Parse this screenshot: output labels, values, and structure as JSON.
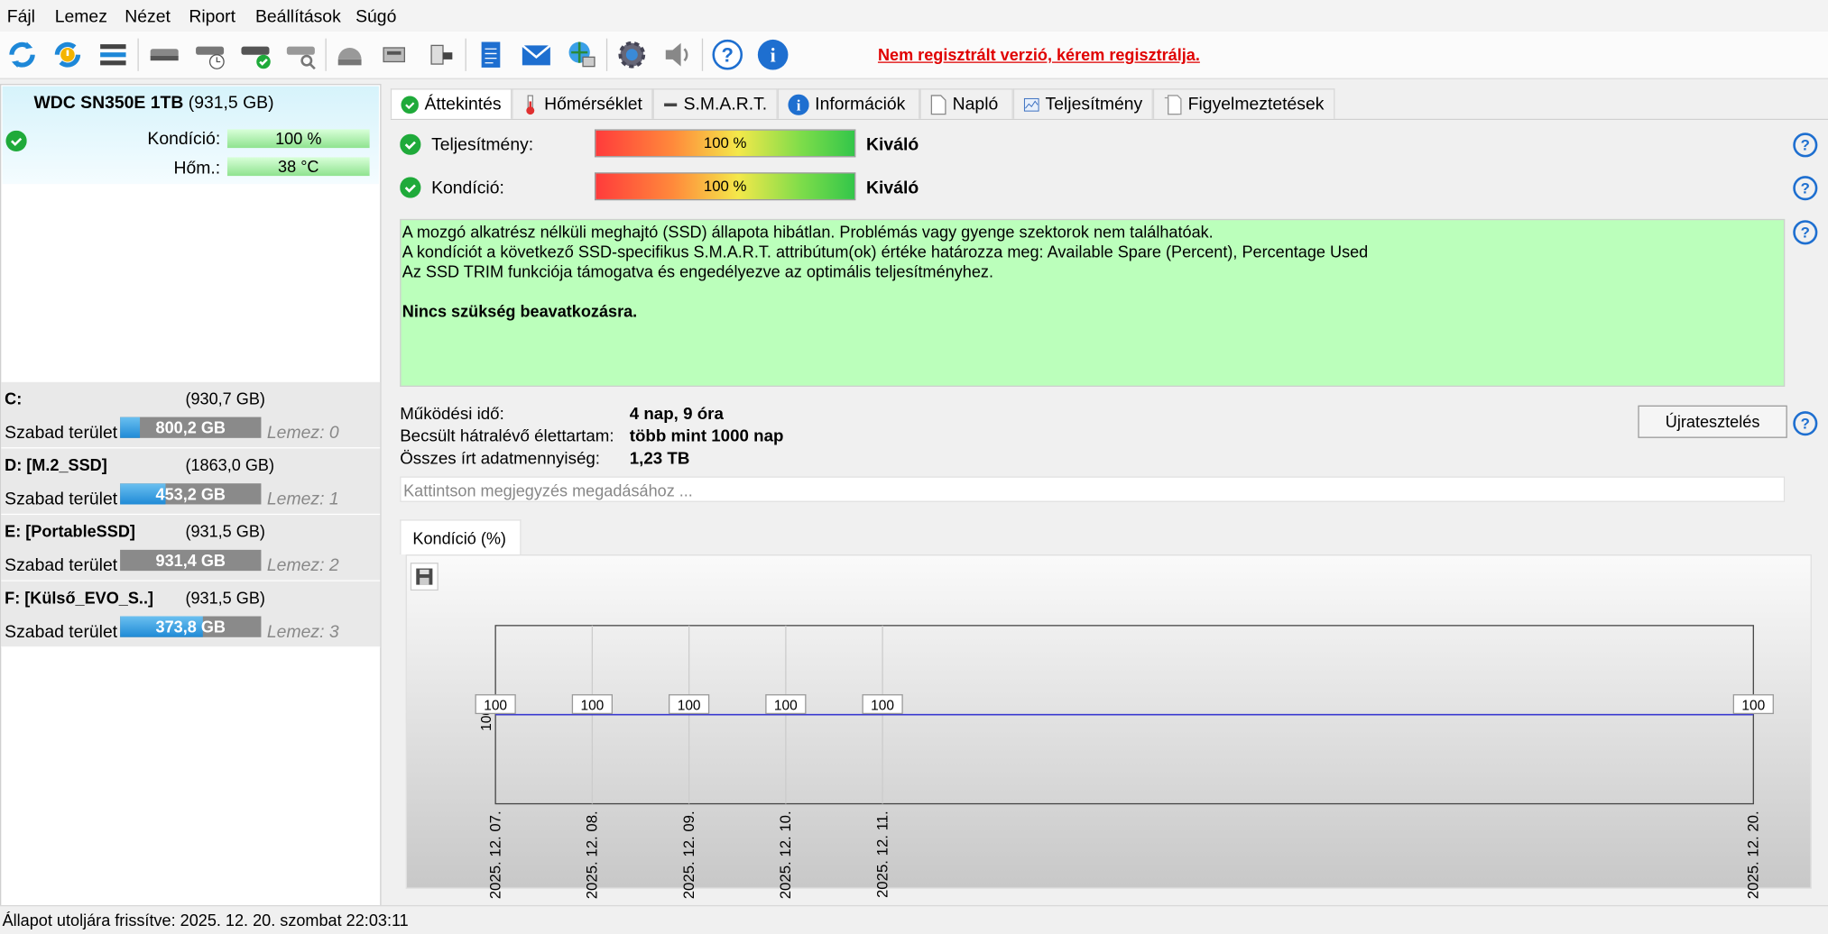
{
  "menu": [
    "Fájl",
    "Lemez",
    "Nézet",
    "Riport",
    "Beállítások",
    "Súgó"
  ],
  "toolbar": {
    "icons": [
      "refresh-icon",
      "refresh-warning-icon",
      "disk-list-icon",
      "disk-icon",
      "disk-schedule-icon",
      "disk-ok-icon",
      "disk-search-icon",
      "disk-gray-icon",
      "usb-disk-icon",
      "usb-drive-icon",
      "notepad-icon",
      "mail-icon",
      "network-globe-icon",
      "settings-gear-icon",
      "speaker-icon",
      "help-icon",
      "info-icon"
    ],
    "register_text": "Nem regisztrált verzió, kérem regisztrálja."
  },
  "disk": {
    "name": "WDC SN350E 1TB",
    "size": "(931,5 GB)",
    "condition_label": "Kondíció:",
    "condition_value": "100 %",
    "temp_label": "Hőm.:",
    "temp_value": "38 °C"
  },
  "volumes": [
    {
      "name": "C:",
      "size": "(930,7 GB)",
      "free_label": "Szabad terület",
      "free": "800,2 GB",
      "fill": 0.14,
      "disk": "Lemez: 0"
    },
    {
      "name": "D: [M.2_SSD]",
      "size": "(1863,0 GB)",
      "free_label": "Szabad terület",
      "free": "453,2 GB",
      "fill": 0.32,
      "disk": "Lemez: 1"
    },
    {
      "name": "E: [PortableSSD]",
      "size": "(931,5 GB)",
      "free_label": "Szabad terület",
      "free": "931,4 GB",
      "fill": 0.0,
      "disk": "Lemez: 2"
    },
    {
      "name": "F: [Külső_EVO_S..]",
      "size": "(931,5 GB)",
      "free_label": "Szabad terület",
      "free": "373,8 GB",
      "fill": 0.59,
      "disk": "Lemez: 3"
    }
  ],
  "tabs": [
    "Áttekintés",
    "Hőmérséklet",
    "S.M.A.R.T.",
    "Információk",
    "Napló",
    "Teljesítmény",
    "Figyelmeztetések"
  ],
  "overview": {
    "perf_label": "Teljesítmény:",
    "perf_value": "100 %",
    "perf_rating": "Kiváló",
    "cond_label": "Kondíció:",
    "cond_value": "100 %",
    "cond_rating": "Kiváló",
    "status_lines": [
      "A mozgó alkatrész nélküli meghajtó (SSD) állapota hibátlan. Problémás vagy gyenge szektorok nem találhatóak.",
      "A kondíciót a következő SSD-specifikus S.M.A.R.T. attribútum(ok) értéke határozza meg:  Available Spare (Percent), Percentage Used",
      "Az SSD TRIM funkciója támogatva és engedélyezve az optimális teljesítményhez."
    ],
    "status_action": "Nincs szükség beavatkozásra.",
    "uptime_label": "Működési idő:",
    "uptime_value": "4 nap, 9 óra",
    "life_label": "Becsült hátralévő élettartam:",
    "life_value": "több mint 1000 nap",
    "written_label": "Összes írt adatmennyiség:",
    "written_value": "1,23 TB",
    "retest_button": "Újratesztelés",
    "note_placeholder": "Kattintson megjegyzés megadásához ...",
    "chart_tab": "Kondíció  (%)"
  },
  "chart_data": {
    "type": "line",
    "x": [
      "2025. 12. 07.",
      "2025. 12. 08.",
      "2025. 12. 09.",
      "2025. 12. 10.",
      "2025. 12. 11.",
      "2025. 12. 20."
    ],
    "series": [
      {
        "values": [
          100,
          100,
          100,
          100,
          100,
          100
        ]
      }
    ],
    "xlabel": "",
    "ylabel": "",
    "y_axis_tick": "100",
    "grid": true,
    "line_color": "#3a3ad0"
  },
  "statusbar": "Állapot utoljára frissítve: 2025. 12. 20. szombat 22:03:11"
}
